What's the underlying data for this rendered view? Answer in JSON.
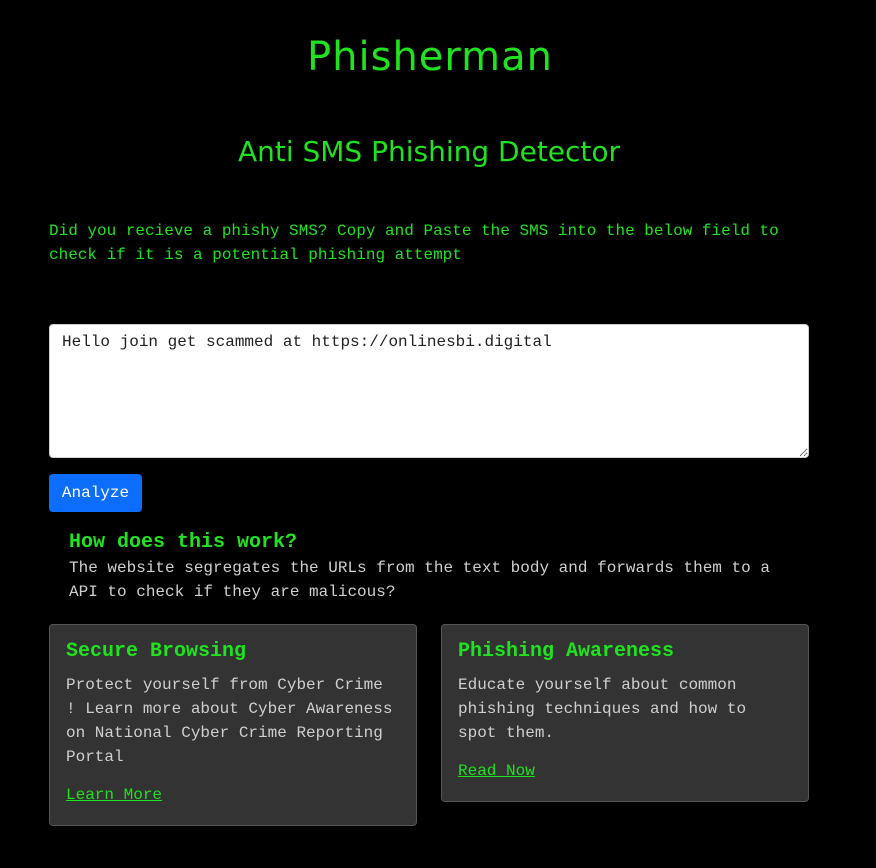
{
  "header": {
    "title": "Phisherman",
    "subtitle": "Anti SMS Phishing Detector"
  },
  "intro": {
    "text": "Did you recieve a phishy SMS? Copy and Paste the SMS into the below field to check if it is a potential phishing attempt"
  },
  "sms_field": {
    "value": "Hello join get scammed at https://onlinesbi.digital"
  },
  "analyze": {
    "label": "Analyze"
  },
  "how": {
    "title": "How does this work?",
    "body": "The website segregates the URLs from the text body and forwards them to a API to check if they are malicous?"
  },
  "cards": [
    {
      "title": "Secure Browsing",
      "text": "Protect yourself from Cyber Crime ! Learn more about Cyber Awareness on National Cyber Crime Reporting Portal",
      "link": "Learn More"
    },
    {
      "title": "Phishing Awareness",
      "text": "Educate yourself about common phishing techniques and how to spot them.",
      "link": "Read Now"
    }
  ],
  "colors": {
    "background": "#000000",
    "accent_green": "#1ee31e",
    "button_blue": "#0d6efd",
    "card_bg": "#333333"
  }
}
